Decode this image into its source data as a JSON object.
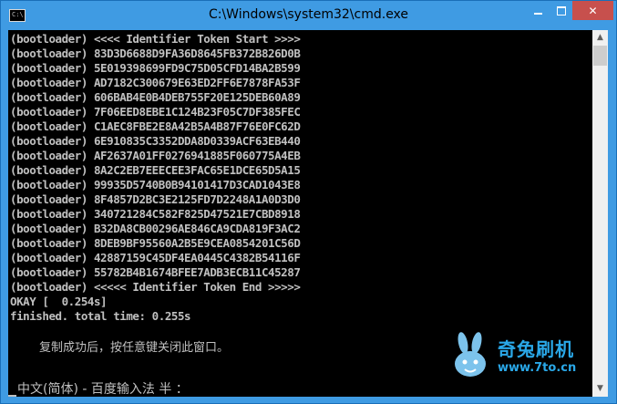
{
  "window": {
    "title": "C:\\Windows\\system32\\cmd.exe",
    "icon_label": "C:\\",
    "controls": {
      "minimize": "minimize-icon",
      "maximize": "maximize-icon",
      "close": "✕"
    }
  },
  "console": {
    "lines": [
      "(bootloader) <<<< Identifier Token Start >>>>",
      "(bootloader) 83D3D6688D9FA36D8645FB372B826D0B",
      "(bootloader) 5E019398699FD9C75D05CFD14BA2B599",
      "(bootloader) AD7182C300679E63ED2FF6E7878FA53F",
      "(bootloader) 606BAB4E0B4DEB755F20E125DEB60A89",
      "(bootloader) 7F06EED8EBE1C124B23F05C7DF385FEC",
      "(bootloader) C1AEC8FBE2E8A42B5A4B87F76E0FC62D",
      "(bootloader) 6E910835C3352DDA8D0339ACF63EB440",
      "(bootloader) AF2637A01FF0276941885F060775A4EB",
      "(bootloader) 8A2C2EB7EEECEE3FAC65E1DCE65D5A15",
      "(bootloader) 99935D5740B0B94101417D3CAD1043E8",
      "(bootloader) 8F4857D2BC3E2125FD7D2248A1A0D3D0",
      "(bootloader) 340721284C582F825D47521E7CBD8918",
      "(bootloader) B32DA8CB00296AE846CA9CDA819F3AC2",
      "(bootloader) 8DEB9BF95560A2B5E9CEA0854201C56D",
      "(bootloader) 42887159C45DF4EA0445C4382B54116F",
      "(bootloader) 55782B4B1674BFEE7ADB3ECB11C45287",
      "(bootloader) <<<<< Identifier Token End >>>>>",
      "OKAY [  0.254s]",
      "finished. total time: 0.255s"
    ],
    "message": "复制成功后，按任意键关闭此窗口。",
    "ime_status": "中文(简体) - 百度输入法 半 ："
  },
  "watermark": {
    "brand": "奇兔刷机",
    "url": "www.7to.cn",
    "logo_icon": "rabbit-logo-icon"
  },
  "scrollbar": {
    "up": "▲",
    "down": "▼"
  }
}
